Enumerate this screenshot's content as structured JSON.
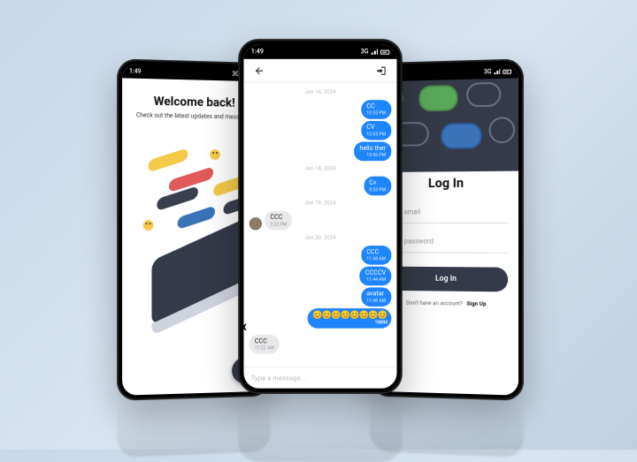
{
  "status": {
    "time": "1:49",
    "net": "3G"
  },
  "welcome": {
    "title": "Welcome back!",
    "subtitle": "Check out the latest updates and messages"
  },
  "chat": {
    "dates": {
      "d1": "Jun 14, 2024",
      "d2": "Jun 18, 2024",
      "d3": "Jun 19, 2024",
      "d4": "Jun 20, 2024"
    },
    "msgs": {
      "m1": {
        "text": "CC",
        "ts": "10:55 PM"
      },
      "m2": {
        "text": "CV",
        "ts": "10:55 PM"
      },
      "m3": {
        "text": "hello ther",
        "ts": "10:56 PM"
      },
      "m4": {
        "text": "Cv",
        "ts": "8:53 PM"
      },
      "m5": {
        "text": "CCC",
        "ts": "3:22 PM"
      },
      "m6": {
        "text": "CCC",
        "ts": "11:44 AM"
      },
      "m7": {
        "text": "CCCCV",
        "ts": "11:44 AM"
      },
      "m8": {
        "text": "avatar",
        "ts": "11:48 AM"
      },
      "m9": {
        "text": "😊😊😊😊😊😊😊😊",
        "ts": "11:48 AM"
      },
      "m10": {
        "text": "CCC",
        "ts": "11:22 AM"
      }
    },
    "input_placeholder": "Type a message..."
  },
  "login": {
    "title": "Log In",
    "email_placeholder": "Enter email",
    "password_placeholder": "Enter password",
    "button": "Log In",
    "footer_q": "Don't have an account?",
    "footer_link": "Sign Up"
  }
}
